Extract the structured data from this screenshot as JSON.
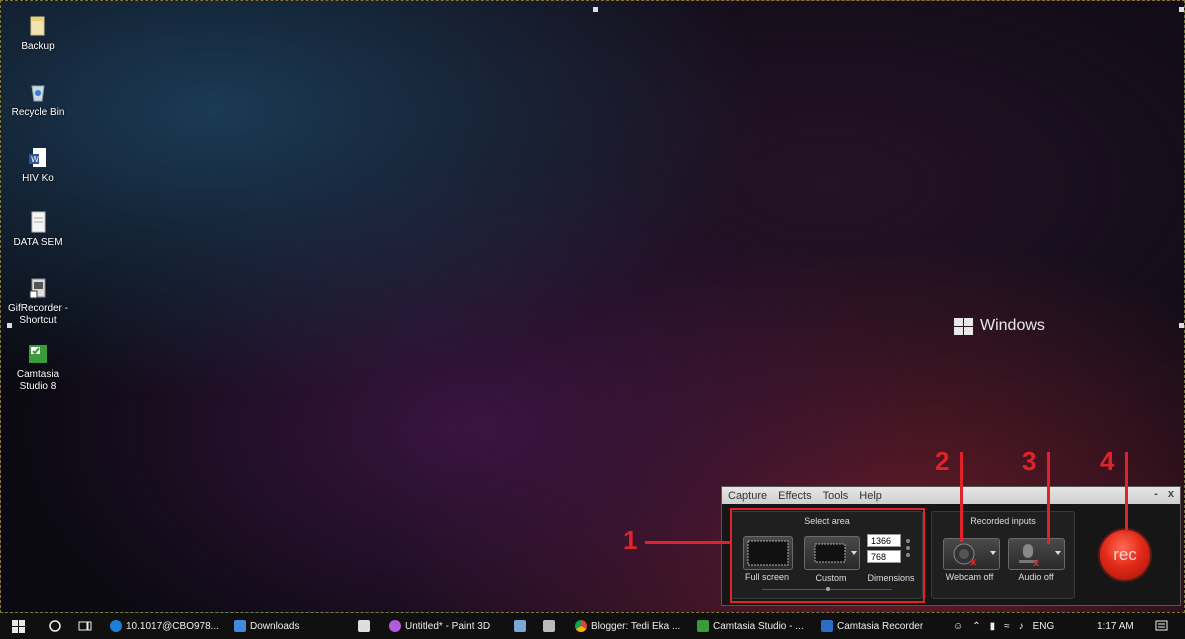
{
  "desktop_icons": [
    {
      "label": "Backup"
    },
    {
      "label": "Recycle Bin"
    },
    {
      "label": "HIV Ko"
    },
    {
      "label": "DATA SEM"
    },
    {
      "label": "GifRecorder - Shortcut"
    },
    {
      "label": "Camtasia Studio 8"
    }
  ],
  "watermark": "Windows",
  "annotations": [
    "1",
    "2",
    "3",
    "4"
  ],
  "recorder": {
    "menu": [
      "Capture",
      "Effects",
      "Tools",
      "Help"
    ],
    "minimize": "-",
    "close": "x",
    "select_area_title": "Select area",
    "full_screen_label": "Full screen",
    "custom_label": "Custom",
    "width": "1366",
    "height": "768",
    "dimensions_label": "Dimensions",
    "recorded_inputs_title": "Recorded inputs",
    "webcam_label": "Webcam off",
    "audio_label": "Audio off",
    "rec_label": "rec"
  },
  "taskbar": {
    "items": [
      {
        "label": "10.1017@CBO978..."
      },
      {
        "label": "Downloads"
      },
      {
        "label": "Untitled* - Paint 3D"
      },
      {
        "label": "Blogger: Tedi Eka ..."
      },
      {
        "label": "Camtasia Studio - ..."
      },
      {
        "label": "Camtasia Recorder"
      }
    ],
    "language": "ENG",
    "time": "1:17 AM"
  },
  "colors": {
    "annotation": "#e0232a",
    "rec_button": "#e22a18"
  }
}
